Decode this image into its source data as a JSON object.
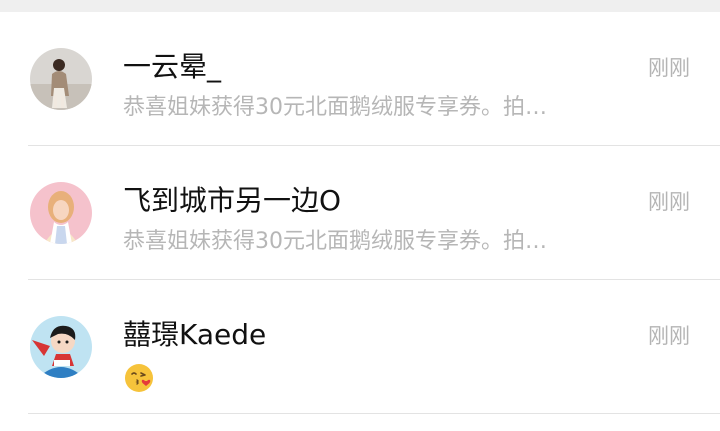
{
  "chats": [
    {
      "name": "一云晕_",
      "time": "刚刚",
      "preview": "恭喜姐妹获得30元北面鹅绒服专享券。拍…"
    },
    {
      "name": "飞到城市另一边O",
      "time": "刚刚",
      "preview": "恭喜姐妹获得30元北面鹅绒服专享券。拍…"
    },
    {
      "name": "囍璟Kaede",
      "time": "刚刚",
      "preview_emoji": "face-blowing-kiss-emoji"
    }
  ],
  "colors": {
    "name_text": "#111111",
    "secondary_text": "#b4b4b4",
    "divider": "#e3e3e3",
    "header_strip": "#efefef"
  }
}
